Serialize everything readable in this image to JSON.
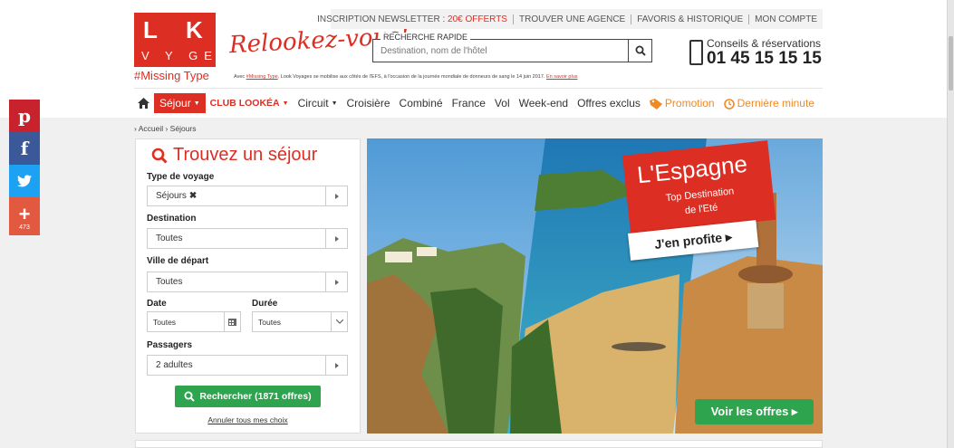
{
  "colors": {
    "brand_red": "#dd2e23",
    "accent_orange": "#f08a24",
    "cta_green": "#2ea44f"
  },
  "share": {
    "pinterest_glyph": "p",
    "facebook_glyph": "f",
    "plus_glyph": "+",
    "plus_count": "473"
  },
  "logo": {
    "letter_l": "L",
    "letter_k": "K",
    "subline": "V Y GES",
    "tag": "#Missing Type",
    "slogan": "Relookez-vous!"
  },
  "toplinks": {
    "newsletter": "INSCRIPTION NEWSLETTER : ",
    "newsletter_offer": "20€ OFFERTS",
    "agency": "TROUVER UNE AGENCE",
    "favorites": "FAVORIS & HISTORIQUE",
    "account": "MON COMPTE"
  },
  "quick_search": {
    "label": "RECHERCHE RAPIDE",
    "placeholder": "Destination, nom de l'hôtel"
  },
  "phone": {
    "label": "Conseils & réservations",
    "number": "01 45 15 15 15"
  },
  "notice": {
    "pre": "Avec ",
    "tag": "#Missing Type",
    "text": ", Look Voyages se mobilise aux côtés de l'EFS, à l'occasion de la journée mondiale de donneurs de sang le 14 juin 2017. ",
    "more": "En savoir plus"
  },
  "nav": {
    "sejour": "Séjour",
    "club": "CLUB LOOKÉA",
    "circuit": "Circuit",
    "croisiere": "Croisière",
    "combine": "Combiné",
    "france": "France",
    "vol": "Vol",
    "weekend": "Week-end",
    "offres": "Offres exclus",
    "promotion": "Promotion",
    "derniere": "Dernière minute"
  },
  "breadcrumb": "› Accueil › Séjours",
  "search": {
    "title": "Trouvez un séjour",
    "type_label": "Type de voyage",
    "type_value": "Séjours",
    "destination_label": "Destination",
    "destination_value": "Toutes",
    "ville_label": "Ville de départ",
    "ville_value": "Toutes",
    "date_label": "Date",
    "date_value": "Toutes",
    "duree_label": "Durée",
    "duree_value": "Toutes",
    "passagers_label": "Passagers",
    "passagers_value": "2 adultes",
    "button": "Rechercher (1871 offres)",
    "reset": "Annuler tous mes choix"
  },
  "banner": {
    "title": "L'Espagne",
    "sub1": "Top Destination",
    "sub2": "de l'Eté",
    "cta": "J'en profite ▸",
    "offers": "Voir les offres ▸"
  }
}
